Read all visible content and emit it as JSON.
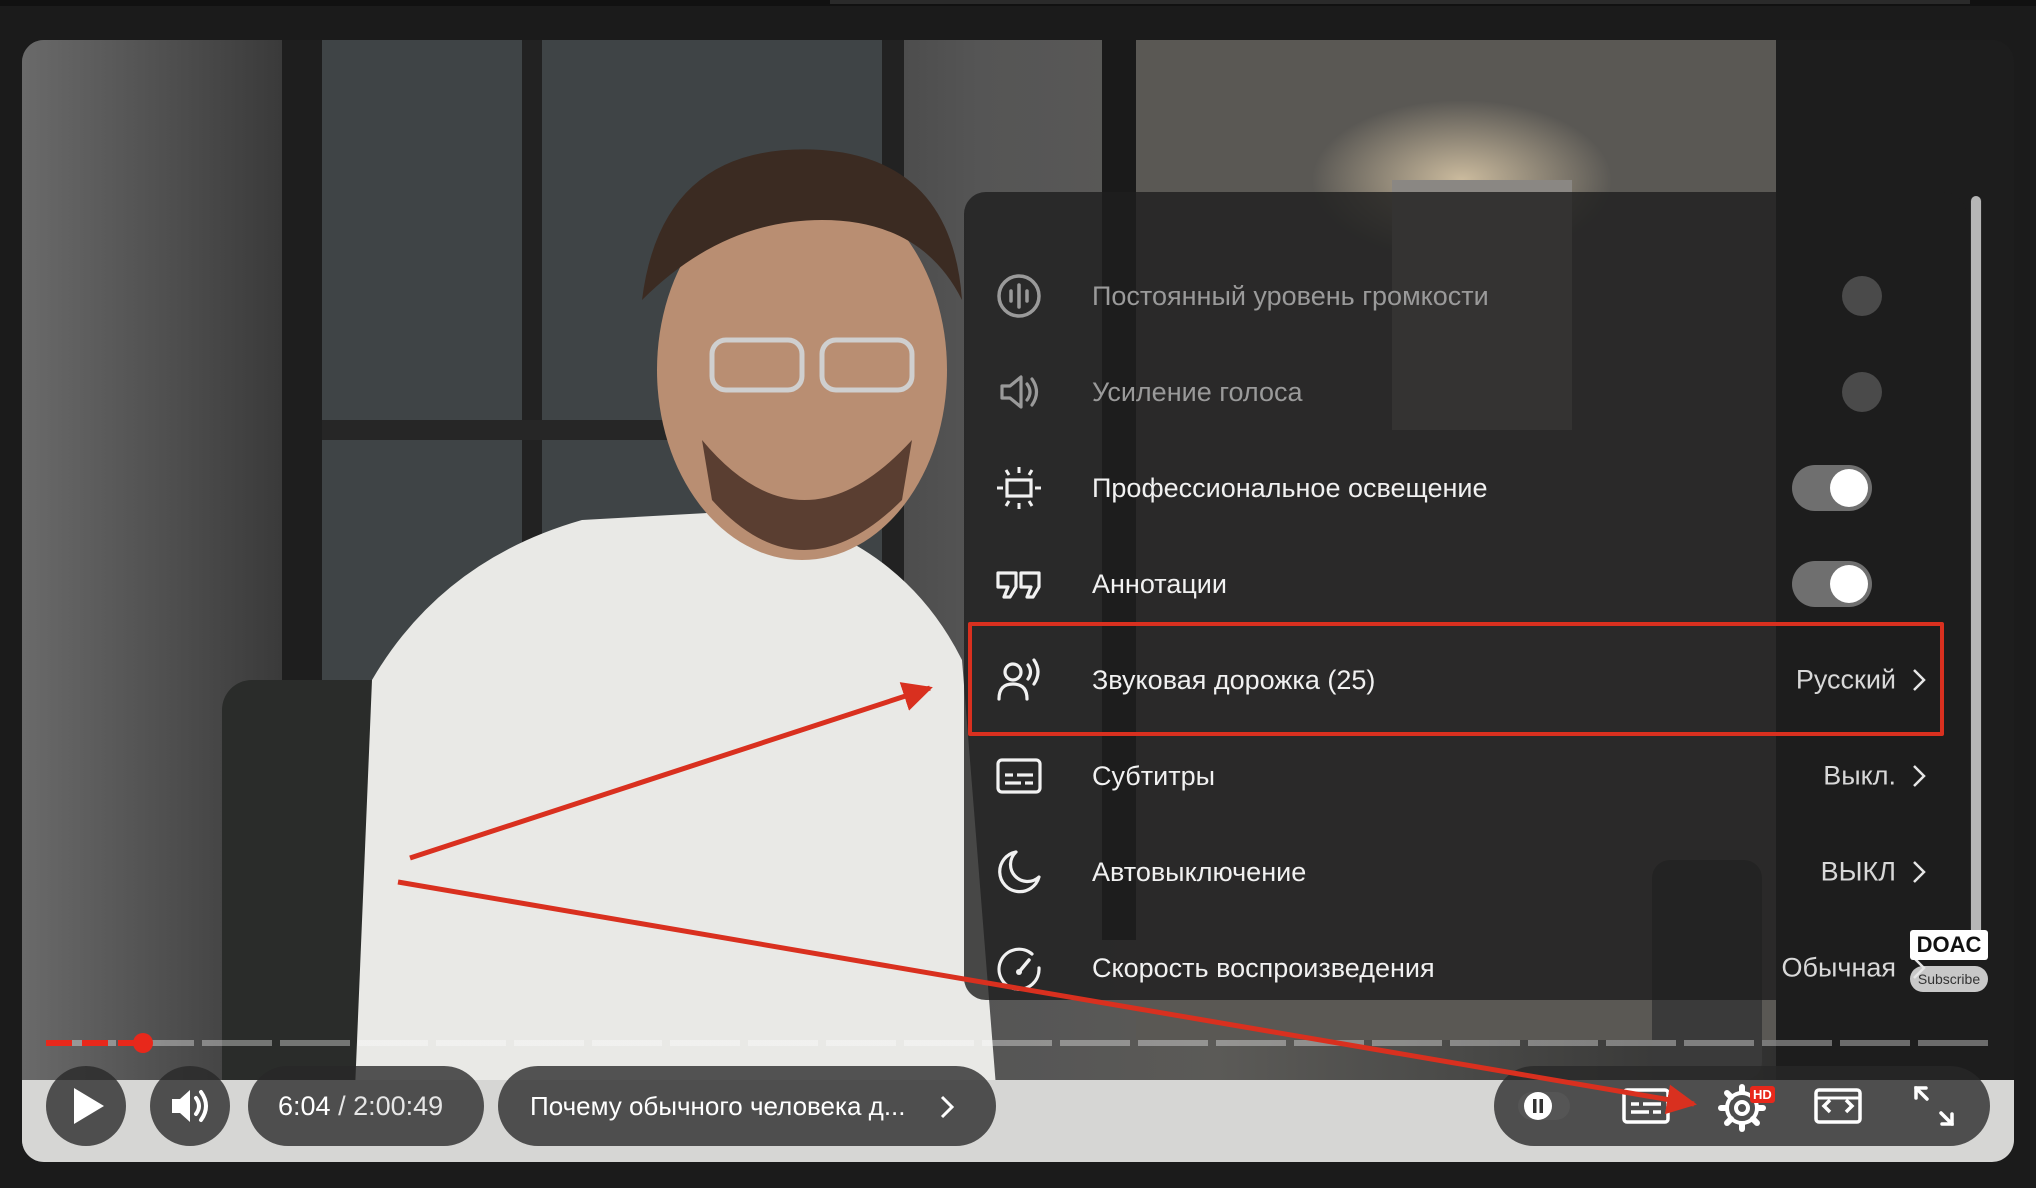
{
  "settings_menu": {
    "items": [
      {
        "label": "Постоянный уровень громкости",
        "state": "off",
        "disabled": true
      },
      {
        "label": "Усиление голоса",
        "state": "off",
        "disabled": true
      },
      {
        "label": "Профессиональное освещение",
        "state": "on"
      },
      {
        "label": "Аннотации",
        "state": "on"
      },
      {
        "label": "Звуковая дорожка (25)",
        "value": "Русский"
      },
      {
        "label": "Субтитры",
        "value": "Выкл."
      },
      {
        "label": "Автовыключение",
        "value": "ВЫКЛ"
      },
      {
        "label": "Скорость воспроизведения",
        "value": "Обычная"
      }
    ]
  },
  "player": {
    "current_time": "6:04",
    "separator": " / ",
    "duration": "2:00:49",
    "video_title": "Почему обычного человека д...",
    "progress_fraction": 0.05,
    "hd_badge": "HD"
  },
  "watermark": {
    "channel": "DOAC",
    "subscribe": "Subscribe"
  },
  "colors": {
    "accent_red": "#e8281b",
    "highlight": "#d9301f"
  }
}
